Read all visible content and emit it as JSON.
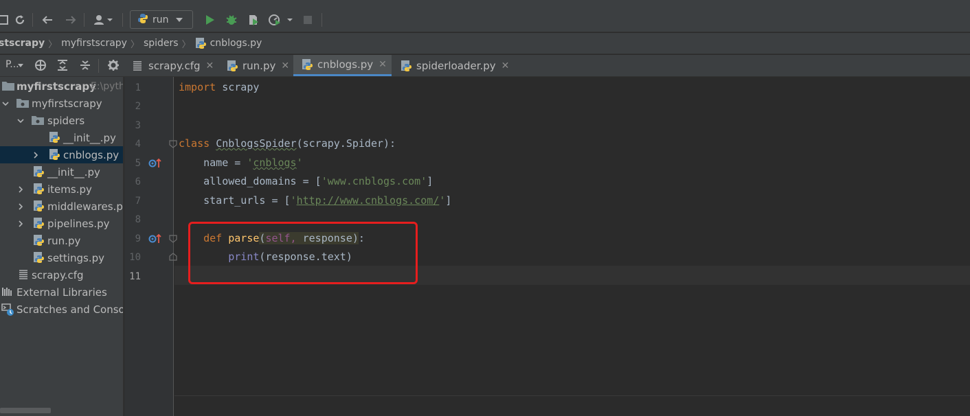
{
  "window": {
    "title_fragment": ""
  },
  "toolbar": {
    "run_config_label": "run",
    "icons": [
      "refresh-icon",
      "back-icon",
      "forward-icon",
      "user-icon",
      "python-icon",
      "run-icon",
      "debug-icon",
      "coverage-icon",
      "profile-icon",
      "stop-icon"
    ]
  },
  "breadcrumb": {
    "items": [
      "stscrapy",
      "myfirstscrapy",
      "spiders",
      "cnblogs.py"
    ]
  },
  "project_panel": {
    "title": "P..."
  },
  "tabs": [
    {
      "label": "scrapy.cfg",
      "icon": "cfg-file-icon",
      "active": false
    },
    {
      "label": "run.py",
      "icon": "python-file-icon",
      "active": false
    },
    {
      "label": "cnblogs.py",
      "icon": "python-file-icon",
      "active": true
    },
    {
      "label": "spiderloader.py",
      "icon": "python-file-icon",
      "active": false
    }
  ],
  "tree": {
    "root": {
      "label": "myfirstscrapy",
      "hint": "E:\\pyth"
    },
    "items": [
      {
        "label": "myfirstscrapy",
        "type": "folder",
        "expanded": true
      },
      {
        "label": "spiders",
        "type": "folder",
        "expanded": true
      },
      {
        "label": "__init__.py",
        "type": "python"
      },
      {
        "label": "cnblogs.py",
        "type": "python",
        "selected": true
      },
      {
        "label": "__init__.py",
        "type": "python"
      },
      {
        "label": "items.py",
        "type": "python"
      },
      {
        "label": "middlewares.py",
        "type": "python"
      },
      {
        "label": "pipelines.py",
        "type": "python"
      },
      {
        "label": "run.py",
        "type": "python"
      },
      {
        "label": "settings.py",
        "type": "python"
      },
      {
        "label": "scrapy.cfg",
        "type": "cfg"
      },
      {
        "label": "External Libraries",
        "type": "library"
      },
      {
        "label": "Scratches and Consol",
        "type": "scratch"
      }
    ]
  },
  "editor": {
    "line_numbers": [
      "1",
      "2",
      "3",
      "4",
      "5",
      "6",
      "7",
      "8",
      "9",
      "10",
      "11"
    ],
    "current_line": "11",
    "code": {
      "l1_kw": "import",
      "l1_rest": " scrapy",
      "l4_kw": "class ",
      "l4_name": "CnblogsSpider",
      "l4_rest": "(scrapy.Spider):",
      "l5_a": "    name = ",
      "l5_q1": "'",
      "l5_s": "cnblogs",
      "l5_q2": "'",
      "l6_a": "    allowed_domains = [",
      "l6_s": "'www.cnblogs.com'",
      "l6_b": "]",
      "l7_a": "    start_urls = [",
      "l7_q1": "'",
      "l7_s": "http://www.cnblogs.com/",
      "l7_q2": "'",
      "l7_b": "]",
      "l9_kw": "    def ",
      "l9_fn": "parse",
      "l9_p1": "(",
      "l9_self": "self, ",
      "l9_resp": "response",
      "l9_p2": ")",
      "l9_colon": ":",
      "l10_indent": "        ",
      "l10_bi": "print",
      "l10_rest": "(response.text)"
    }
  },
  "annotation": {
    "color": "#e61e1e"
  }
}
